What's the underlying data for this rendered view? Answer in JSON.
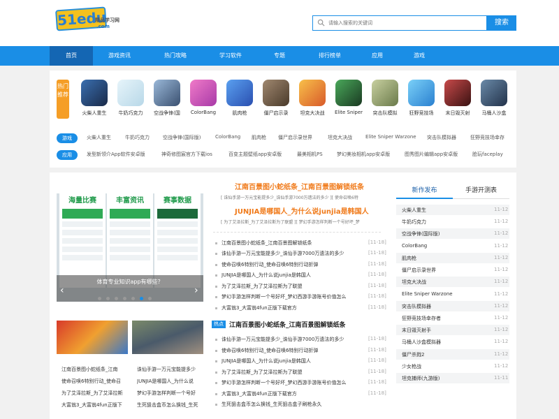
{
  "logo": {
    "number": "51edu",
    "slogan": "精品学习网",
    "domain": ".com"
  },
  "search": {
    "placeholder": "请输入搜索的关键词",
    "button": "搜索"
  },
  "nav": [
    "首页",
    "游戏资讯",
    "热门攻略",
    "学习软件",
    "专题",
    "排行榜单",
    "应用",
    "游戏"
  ],
  "hot": {
    "label": "热门推荐"
  },
  "apps": [
    {
      "name": "火柴人重生",
      "color": "#3a6fb0"
    },
    {
      "name": "牛奶巧克力",
      "color": "#cfe6f0"
    },
    {
      "name": "空战争锋(国",
      "color": "#6a88a8"
    },
    {
      "name": "ColorBang",
      "color": "#d84fa8"
    },
    {
      "name": "肌肉枪",
      "color": "#3b7fd8"
    },
    {
      "name": "僵尸启示录",
      "color": "#7d6a58"
    },
    {
      "name": "坦克大决战",
      "color": "#e8922c"
    },
    {
      "name": "Elite Sniper",
      "color": "#2a6a3a"
    },
    {
      "name": "突击队模拟",
      "color": "#8fa06a"
    },
    {
      "name": "狂野竞技场",
      "color": "#3aa0e0"
    },
    {
      "name": "末日毁灭射",
      "color": "#8a2a2a"
    },
    {
      "name": "马桶人沙盒",
      "color": "#3a5a78"
    }
  ],
  "game_tags": {
    "label": "游戏",
    "items": [
      "火柴人重生",
      "牛奶巧克力",
      "空战争锋(国际版)",
      "ColorBang",
      "肌肉枪",
      "僵尸启示录世界",
      "坦克大决战",
      "Elite Sniper Warzone",
      "突击队模拟器",
      "狂野竞技场幸存"
    ]
  },
  "app_tags": {
    "label": "应用",
    "items": [
      "发型新领介App软件安卓版",
      "神奇修图宸官方下载ios",
      "百变主题壁纸app安卓版",
      "最美相机PS",
      "梦幻美妆相机app安卓版",
      "图秀图片编辑app安卓版",
      "脸玩faceplay"
    ]
  },
  "slider": {
    "caption": "体育专业知识app有哪些？",
    "phones": [
      "海量比赛",
      "丰富资讯",
      "赛事数据"
    ],
    "arrow_left": "‹",
    "arrow_right": "›"
  },
  "left_list": [
    [
      "江南百景图小蛇纸条_江南",
      "诛仙手游一万元宝能提多少"
    ],
    [
      "使命召唤6特别行动_使命召",
      "JUNJIA是哪国人_为什么说"
    ],
    [
      "为了艾泽拉斯_为了艾泽拉斯",
      "梦幻手游怎样判断一个号好"
    ],
    [
      "大富翁3_大富翁4fun正版下",
      "生死狙击盒币怎么换钱_生死"
    ]
  ],
  "headline1": {
    "title": "江南百景图小蛇纸条_江南百景图解锁纸条",
    "sub": "[ 诛仙手游一万元宝能提多少_诛仙手游7000万遗法的多少 ][ 使命召唤6特"
  },
  "headline2": {
    "title": "JUNJIA是哪国人_为什么说junjia是韩国人",
    "sub": "[ 为了艾泽拉斯_为了艾泽拉斯为了联盟 ][ 梦幻手游怎样判断一个号好坏_梦"
  },
  "news1": [
    {
      "t": "江南百景图小蛇纸条_江南百景图解锁纸条",
      "d": "[11-18]"
    },
    {
      "t": "诛仙手游一万元宝能提多少_诛仙手游7000万遗法的多少",
      "d": "[11-18]"
    },
    {
      "t": "使命召唤6特别行动_使命召唤6特别行动折弹",
      "d": "[11-18]"
    },
    {
      "t": "JUNJIA是哪国人_为什么说junjia是韩国人",
      "d": "[11-18]"
    },
    {
      "t": "为了艾泽拉斯_为了艾泽拉斯为了联盟",
      "d": "[11-18]"
    },
    {
      "t": "梦幻手游怎样判断一个号好坏_梦幻西游手游账号价值怎么",
      "d": "[11-18]"
    },
    {
      "t": "大富翁3_大富翁4fun正版下载官方",
      "d": "[11-18]"
    }
  ],
  "hot_section": {
    "badge": "热点",
    "title": "江南百景图小蛇纸条_江南百景图解锁纸条"
  },
  "news2": [
    {
      "t": "诛仙手游一万元宝能提多少_诛仙手游7000万遗法的多少",
      "d": "[11-18]"
    },
    {
      "t": "使命召唤6特别行动_使命召唤6特别行动折弹",
      "d": "[11-18]"
    },
    {
      "t": "JUNJIA是哪国人_为什么说junjia是韩国人",
      "d": "[11-18]"
    },
    {
      "t": "为了艾泽拉斯_为了艾泽拉斯为了联盟",
      "d": "[11-18]"
    },
    {
      "t": "梦幻手游怎样判断一个号好坏_梦幻西游手游账号价值怎么",
      "d": "[11-18]"
    },
    {
      "t": "大富翁3_大富翁4fun正版下载官方",
      "d": "[11-18]"
    },
    {
      "t": "生死狙击盒币怎么换钱_生死狙击盒子刷枪永久",
      "d": ""
    }
  ],
  "tabs": [
    "新作发布",
    "手游开测表"
  ],
  "right_list": [
    {
      "t": "火柴人重生",
      "d": "11-12"
    },
    {
      "t": "牛奶巧克力",
      "d": "11-12"
    },
    {
      "t": "空战争锋(国际版)",
      "d": "11-12"
    },
    {
      "t": "ColorBang",
      "d": "11-12"
    },
    {
      "t": "肌肉枪",
      "d": "11-12"
    },
    {
      "t": "僵尸启示录世界",
      "d": "11-12"
    },
    {
      "t": "坦克大决战",
      "d": "11-12"
    },
    {
      "t": "Elite Sniper Warzone",
      "d": "11-12"
    },
    {
      "t": "突击队模拟器",
      "d": "11-12"
    },
    {
      "t": "狂野竞技场幸存者",
      "d": "11-12"
    },
    {
      "t": "末日毁灭射手",
      "d": "11-12"
    },
    {
      "t": "马桶人沙盒模拟器",
      "d": "11-12"
    },
    {
      "t": "僵尸杀戮2",
      "d": "11-12"
    },
    {
      "t": "少女枪战",
      "d": "11-12"
    },
    {
      "t": "坦克捕师(九游版)",
      "d": "11-11"
    }
  ]
}
